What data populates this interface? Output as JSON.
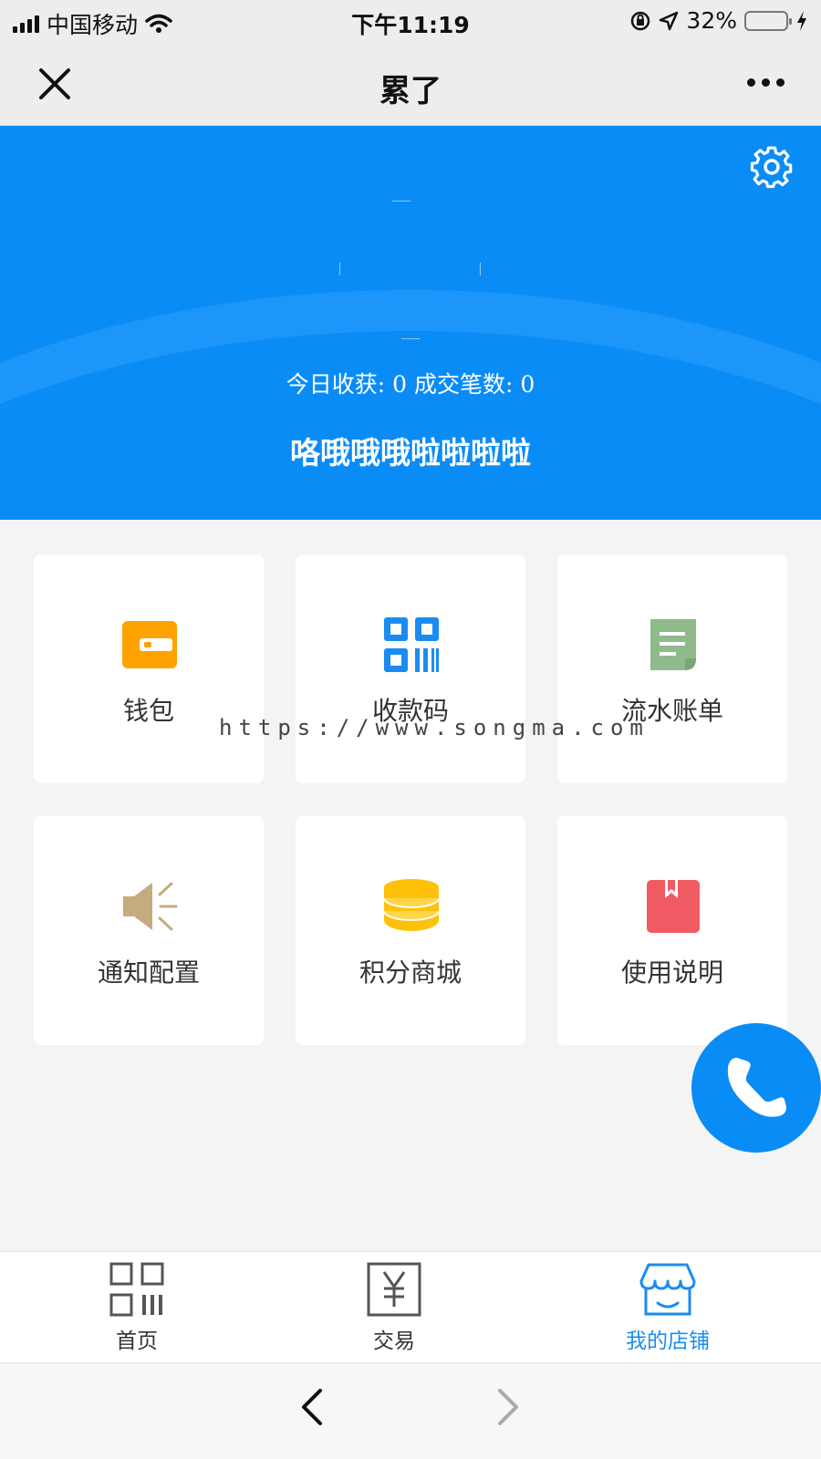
{
  "status_bar": {
    "carrier": "中国移动",
    "time": "下午11:19",
    "battery": "32%",
    "battery_level": 0.32
  },
  "nav": {
    "title": "累了"
  },
  "hero": {
    "stats": "今日收获: 0 成交笔数: 0",
    "shop_name": "咯哦哦哦啦啦啦啦"
  },
  "menu": {
    "wallet": "钱包",
    "qr_code": "收款码",
    "statement": "流水账单",
    "notify": "通知配置",
    "points_mall": "积分商城",
    "manual": "使用说明"
  },
  "watermark": "https://www.songma.com",
  "tabs": {
    "home": "首页",
    "trade": "交易",
    "my_shop": "我的店铺"
  },
  "colors": {
    "brand_blue": "#0a8cf7",
    "wallet_orange": "#ffa200",
    "qr_blue": "#1a8cf0",
    "statement_green": "#8fba8b",
    "notify_tan": "#c4ac7e",
    "points_yellow": "#ffc107",
    "manual_red": "#f05a63"
  }
}
